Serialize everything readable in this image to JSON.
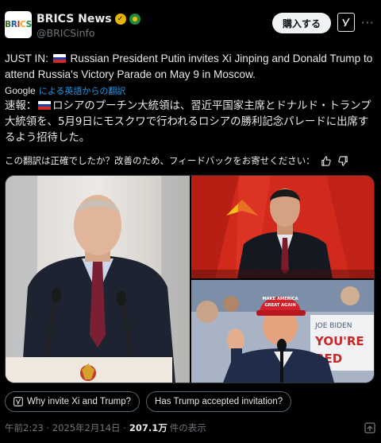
{
  "account": {
    "avatar_text": [
      "B",
      "R",
      "I",
      "C",
      "S"
    ],
    "name": "BRICS News",
    "handle": "@BRICSinfo",
    "subscribe_label": "購入する",
    "grok_icon": "grok-icon",
    "more_icon": "more-dots-icon"
  },
  "tweet": {
    "prefix": "JUST IN: ",
    "body": "Russian President Putin invites Xi Jinping and Donald Trump to attend Russia's Victory Parade on May 9 in Moscow."
  },
  "translation": {
    "google_label": "Google",
    "link": "による英語からの翻訳",
    "prefix": "速報：",
    "body": "ロシアのプーチン大統領は、習近平国家主席とドナルド・トランプ大統領を、5月9日にモスクワで行われるロシアの勝利記念パレードに出席するよう招待した。",
    "feedback": "この翻訳は正確でしたか？改善のため、フィードバックをお寄せください："
  },
  "media": {
    "photo_left_caption": "",
    "sign_trump_hat": [
      "MAKE AMERICA",
      "GREAT AGAIN"
    ],
    "sign_bg": [
      "JOE BIDEN",
      "YOU'RE",
      "RED"
    ]
  },
  "chips": [
    {
      "label": "Why invite Xi and Trump?",
      "icon": "grok-icon"
    },
    {
      "label": "Has Trump accepted invitation?"
    }
  ],
  "meta": {
    "time": "午前2:23 · 2025年2月14日 · ",
    "views": "207.1万",
    "views_label": "件の表示"
  },
  "colors": {
    "background": "#000000",
    "text": "#e7e9ea",
    "muted": "#71767b",
    "link": "#1d9bf0",
    "verified": "#e8b400"
  }
}
